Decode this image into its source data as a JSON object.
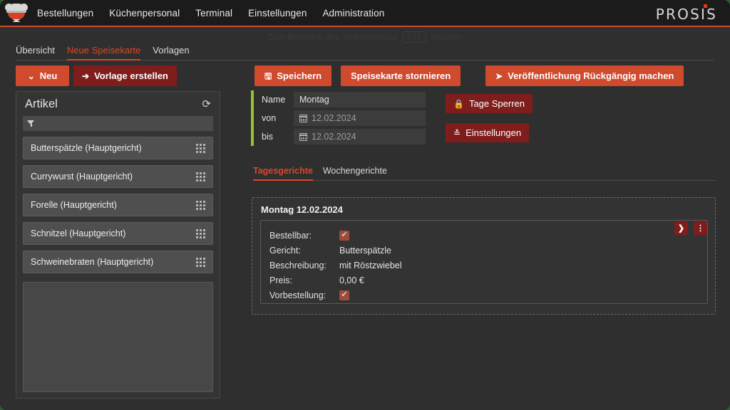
{
  "topbar": {
    "logo_name": "chef-logo",
    "nav": [
      {
        "label": "Bestellungen"
      },
      {
        "label": "Küchenpersonal"
      },
      {
        "label": "Terminal"
      },
      {
        "label": "Einstellungen"
      },
      {
        "label": "Administration"
      }
    ],
    "brand": "PROSIS"
  },
  "fullscreen_hint": {
    "prefix": "Zum Beenden des Vollbildmodus",
    "key": "F11",
    "suffix": "drücken"
  },
  "subnav": {
    "items": [
      {
        "label": "Übersicht",
        "active": false
      },
      {
        "label": "Neue Speisekarte",
        "active": true
      },
      {
        "label": "Vorlagen",
        "active": false
      }
    ]
  },
  "left_actions": {
    "neu_label": "Neu",
    "neu_icon": "chevron-down-icon",
    "vorlage_label": "Vorlage erstellen",
    "vorlage_icon": "arrow-right-icon"
  },
  "toolbar": {
    "save_label": "Speichern",
    "save_icon": "save-icon",
    "cancel_label": "Speisekarte stornieren",
    "unpublish_label": "Veröffentlichung Rückgängig machen",
    "unpublish_icon": "play-arrow-icon",
    "lock_days_label": "Tage Sperren",
    "lock_icon": "lock-icon",
    "settings_label": "Einstellungen",
    "settings_icon": "sliders-icon"
  },
  "articles": {
    "title": "Artikel",
    "refresh_icon": "refresh-icon",
    "filter_icon": "funnel-icon",
    "filter_value": "",
    "filter_placeholder": "",
    "items": [
      {
        "label": "Butterspätzle (Hauptgericht)"
      },
      {
        "label": "Currywurst (Hauptgericht)"
      },
      {
        "label": "Forelle (Hauptgericht)"
      },
      {
        "label": "Schnitzel (Hauptgericht)"
      },
      {
        "label": "Schweinebraten (Hauptgericht)"
      }
    ]
  },
  "form": {
    "accent_color": "#9bbf2e",
    "name_label": "Name",
    "name_value": "Montag",
    "from_label": "von",
    "from_value": "12.02.2024",
    "to_label": "bis",
    "to_value": "12.02.2024",
    "calendar_icon": "calendar-icon"
  },
  "content_tabs": [
    {
      "label": "Tagesgerichte",
      "active": true
    },
    {
      "label": "Wochengerichte",
      "active": false
    }
  ],
  "day_card": {
    "title": "Montag 12.02.2024",
    "orderable_label": "Bestellbar:",
    "orderable_checked": "✔",
    "dish_label": "Gericht:",
    "dish_value": "Butterspätzle",
    "description_label": "Beschreibung:",
    "description_value": "mit Röstzwiebel",
    "price_label": "Preis:",
    "price_value": "0,00 €",
    "preorder_label": "Vorbestellung:",
    "preorder_checked": "✔",
    "expand_icon": "chevron-right-icon",
    "menu_icon": "kebab-menu-icon"
  },
  "colors": {
    "accent_red": "#d04a2d",
    "dark_red": "#7e1d1c",
    "green_accent": "#9bbf2e",
    "background": "#2f2f2f"
  }
}
